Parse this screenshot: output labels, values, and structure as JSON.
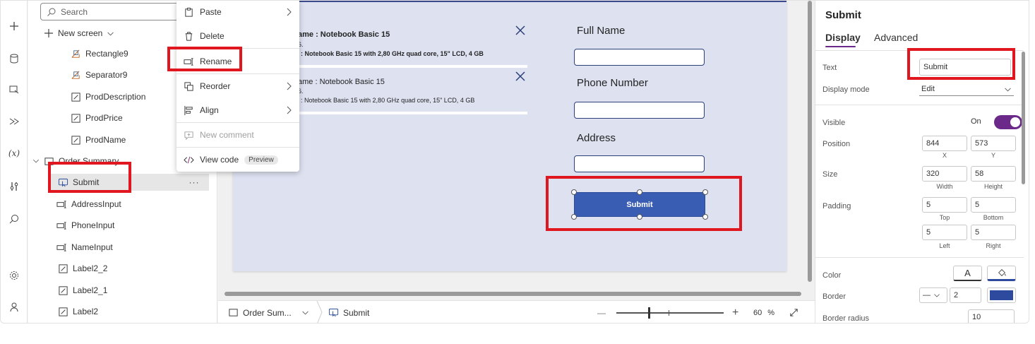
{
  "tree": {
    "search_placeholder": "Search",
    "new_screen": "New screen",
    "items": [
      {
        "label": "Rectangle9",
        "kind": "shape"
      },
      {
        "label": "Separator9",
        "kind": "shape"
      },
      {
        "label": "ProdDescription",
        "kind": "label"
      },
      {
        "label": "ProdPrice",
        "kind": "label"
      },
      {
        "label": "ProdName",
        "kind": "label"
      },
      {
        "label": "Order Summary",
        "kind": "screen"
      },
      {
        "label": "Submit",
        "kind": "button"
      },
      {
        "label": "AddressInput",
        "kind": "input"
      },
      {
        "label": "PhoneInput",
        "kind": "input"
      },
      {
        "label": "NameInput",
        "kind": "input"
      },
      {
        "label": "Label2_2",
        "kind": "label"
      },
      {
        "label": "Label2_1",
        "kind": "label"
      },
      {
        "label": "Label2",
        "kind": "label"
      }
    ],
    "more": "···"
  },
  "context_menu": {
    "paste": "Paste",
    "delete": "Delete",
    "rename": "Rename",
    "reorder": "Reorder",
    "align": "Align",
    "new_comment": "New comment",
    "view_code": "View code",
    "preview_badge": "Preview"
  },
  "canvas": {
    "gallery": [
      {
        "name": "ame :  Notebook Basic 15",
        "small": "6.",
        "desc": ":  Notebook Basic 15 with 2,80 GHz quad core, 15\" LCD, 4 GB"
      },
      {
        "name": "ame :  Notebook Basic 15",
        "small": "6.",
        "desc": ":  Notebook Basic 15 with 2,80 GHz quad core, 15\" LCD, 4 GB"
      }
    ],
    "full_name_label": "Full Name",
    "phone_label": "Phone Number",
    "address_label": "Address",
    "submit_label": "Submit"
  },
  "statusbar": {
    "screen": "Order Sum...",
    "control": "Submit",
    "zoom_minus": "—",
    "zoom_plus": "+",
    "zoom": "60",
    "zoom_unit": "%"
  },
  "props": {
    "title": "Submit",
    "tab_display": "Display",
    "tab_advanced": "Advanced",
    "text_label": "Text",
    "text_value": "Submit",
    "display_mode_label": "Display mode",
    "display_mode_value": "Edit",
    "visible_label": "Visible",
    "visible_value": "On",
    "position_label": "Position",
    "pos_x": "844",
    "pos_y": "573",
    "pos_x_label": "X",
    "pos_y_label": "Y",
    "size_label": "Size",
    "width": "320",
    "height": "58",
    "width_label": "Width",
    "height_label": "Height",
    "padding_label": "Padding",
    "pad_top": "5",
    "pad_bottom": "5",
    "pad_left": "5",
    "pad_right": "5",
    "pad_top_label": "Top",
    "pad_bottom_label": "Bottom",
    "pad_left_label": "Left",
    "pad_right_label": "Right",
    "color_label": "Color",
    "color_font_glyph": "A",
    "border_label": "Border",
    "border_style": "—",
    "border_width": "2",
    "border_color": "#2e4a9e",
    "border_radius_label": "Border radius",
    "border_radius": "10"
  },
  "colors": {
    "accent": "#6b2a8a",
    "button": "#3a5db4",
    "highlight": "#e1171f",
    "canvas": "#dde1f0"
  }
}
